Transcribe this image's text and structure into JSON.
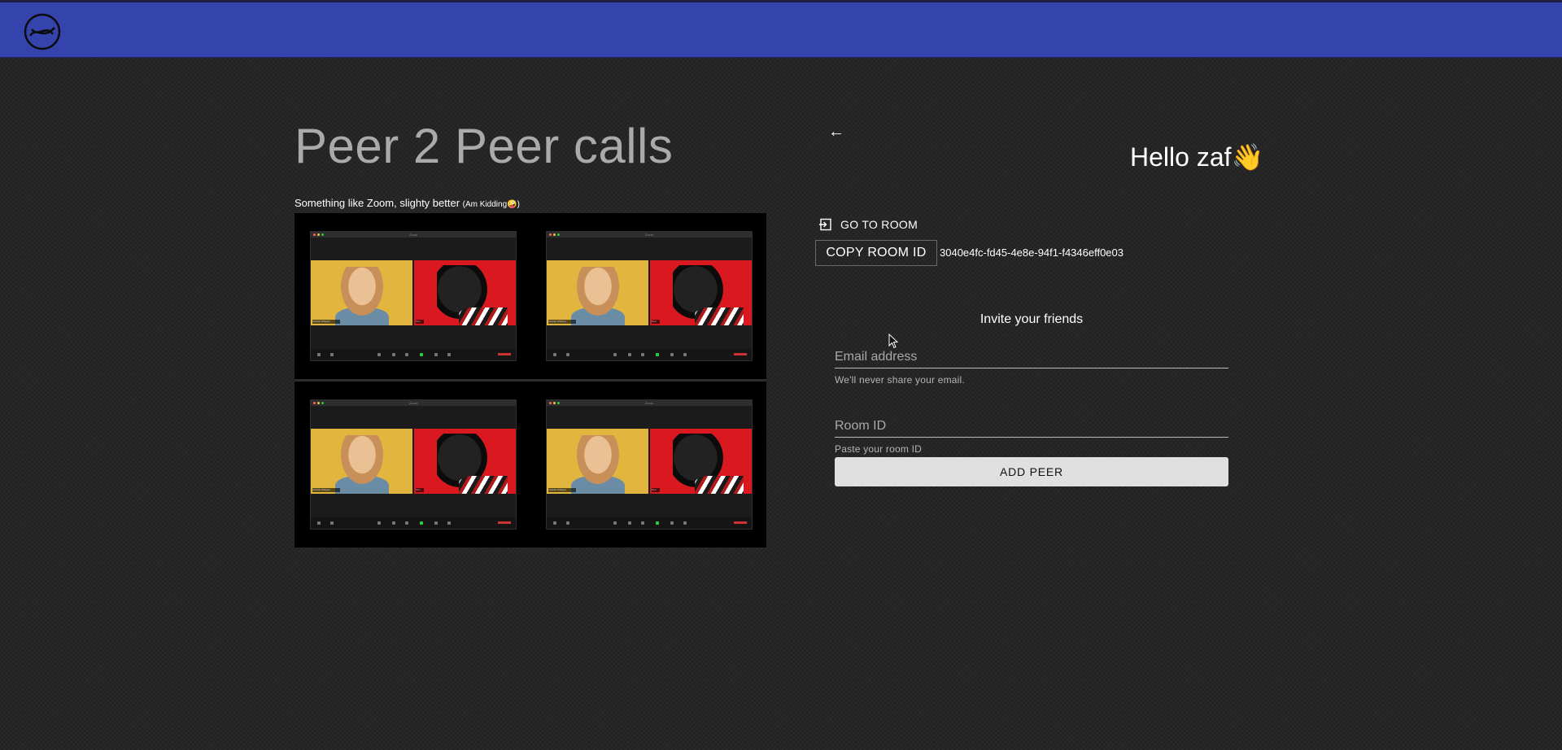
{
  "header": {
    "logo_icon": "circle-swoosh-logo-icon",
    "brand_color": "#3544ad"
  },
  "main": {
    "title": "Peer 2 Peer calls",
    "subtitle": "Something like Zoom, slighty better",
    "subtitle_note": "(Am Kidding🤪)",
    "video_tiles": [
      {
        "window_title": "Zoom",
        "left_name": "Scarlett Whisper",
        "right_name": "Tom"
      },
      {
        "window_title": "Zoom",
        "left_name": "Scarlett Whisper",
        "right_name": "Tom"
      },
      {
        "window_title": "Zoom",
        "left_name": "Scarlett Whisper",
        "right_name": "Tom"
      },
      {
        "window_title": "Zoom",
        "left_name": "Scarlett Whisper",
        "right_name": "Tom"
      }
    ]
  },
  "panel": {
    "back_icon": "←",
    "greeting": "Hello zaf👋",
    "go_to_room_label": "GO TO ROOM",
    "copy_room_id_label": "COPY ROOM ID",
    "room_id": "3040e4fc-fd45-4e8e-94f1-f4346eff0e03",
    "invite_heading": "Invite your friends",
    "email": {
      "value": "",
      "placeholder": "Email address",
      "help": "We'll never share your email."
    },
    "room_input": {
      "value": "",
      "placeholder": "Room ID",
      "help": "Paste your room ID"
    },
    "add_peer_label": "ADD PEER"
  }
}
